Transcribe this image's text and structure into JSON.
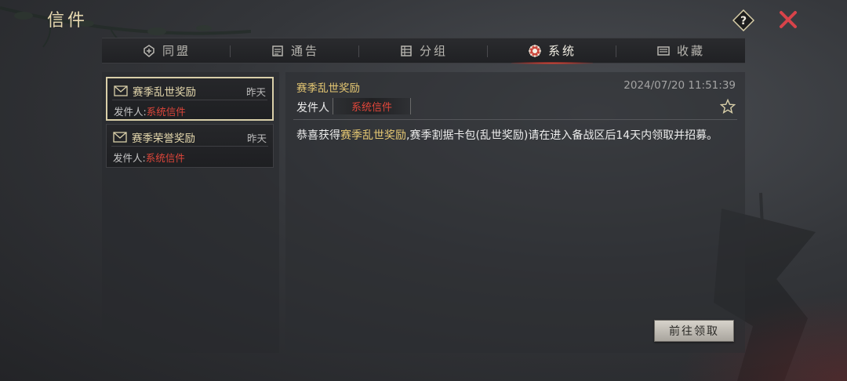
{
  "window": {
    "title": "信件"
  },
  "tabs": [
    {
      "label": "同盟",
      "icon": "alliance-icon",
      "active": false
    },
    {
      "label": "通告",
      "icon": "notice-icon",
      "active": false
    },
    {
      "label": "分组",
      "icon": "group-icon",
      "active": false
    },
    {
      "label": "系统",
      "icon": "system-gear-icon",
      "active": true
    },
    {
      "label": "收藏",
      "icon": "favorites-icon",
      "active": false
    }
  ],
  "mail_list": [
    {
      "subject": "赛季乱世奖励",
      "when": "昨天",
      "sender_prefix": "发件人:",
      "sender": "系统信件",
      "selected": true
    },
    {
      "subject": "赛季荣誉奖励",
      "when": "昨天",
      "sender_prefix": "发件人:",
      "sender": "系统信件",
      "selected": false
    }
  ],
  "detail": {
    "subject": "赛季乱世奖励",
    "date": "2024/07/20 11:51:39",
    "sender_label": "发件人",
    "sender": "系统信件",
    "body_prefix": "恭喜获得",
    "body_highlight": "赛季乱世奖励",
    "body_suffix": ",赛季割据卡包(乱世奖励)请在进入备战区后14天内领取并招募。",
    "claim_label": "前往领取"
  },
  "colors": {
    "accent_gold": "#e6c873",
    "sender_red": "#e0463a",
    "close_red": "#d8434a"
  }
}
